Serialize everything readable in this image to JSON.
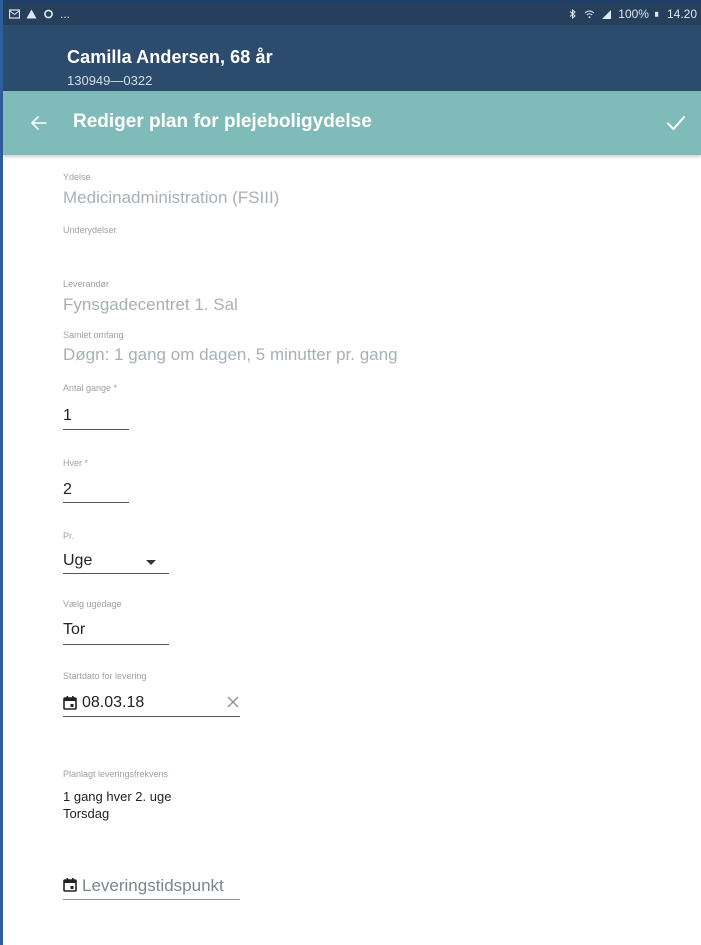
{
  "status_bar": {
    "left_text": "...",
    "battery": "100%",
    "time": "14.20"
  },
  "patient": {
    "name": "Camilla Andersen, 68 år",
    "id": "130949—0322"
  },
  "app_bar": {
    "title": "Rediger plan for plejeboligydelse",
    "back_icon": "arrow-back-icon",
    "save_icon": "check-icon"
  },
  "form": {
    "ydelse_label": "Ydelse",
    "ydelse_value": "Medicinadministration (FSIII)",
    "underydelser_label": "Underydelser",
    "leverandor_label": "Leverandør",
    "leverandor_value": "Fynsgadecentret 1. Sal",
    "samlet_omfang_label": "Samlet omfang",
    "samlet_omfang_value": "Døgn: 1 gang om dagen, 5 minutter pr. gang",
    "antal_gange_label": "Antal gange *",
    "antal_gange_value": "1",
    "hver_label": "Hver *",
    "hver_value": "2",
    "pr_label": "Pr.",
    "pr_value": "Uge",
    "ugedage_label": "Vælg ugedage",
    "ugedage_value": "Tor",
    "startdato_label": "Startdato for levering",
    "startdato_value": "08.03.18",
    "frekvens_label": "Planlagt leveringsfrekvens",
    "frekvens_line1": "1 gang hver 2. uge",
    "frekvens_line2": "Torsdag",
    "leveringstidspunkt_placeholder": "Leveringstidspunkt"
  },
  "colors": {
    "status_bar": "#263f5c",
    "patient_bar": "#2c4c6d",
    "app_bar": "#7fbcb9"
  }
}
